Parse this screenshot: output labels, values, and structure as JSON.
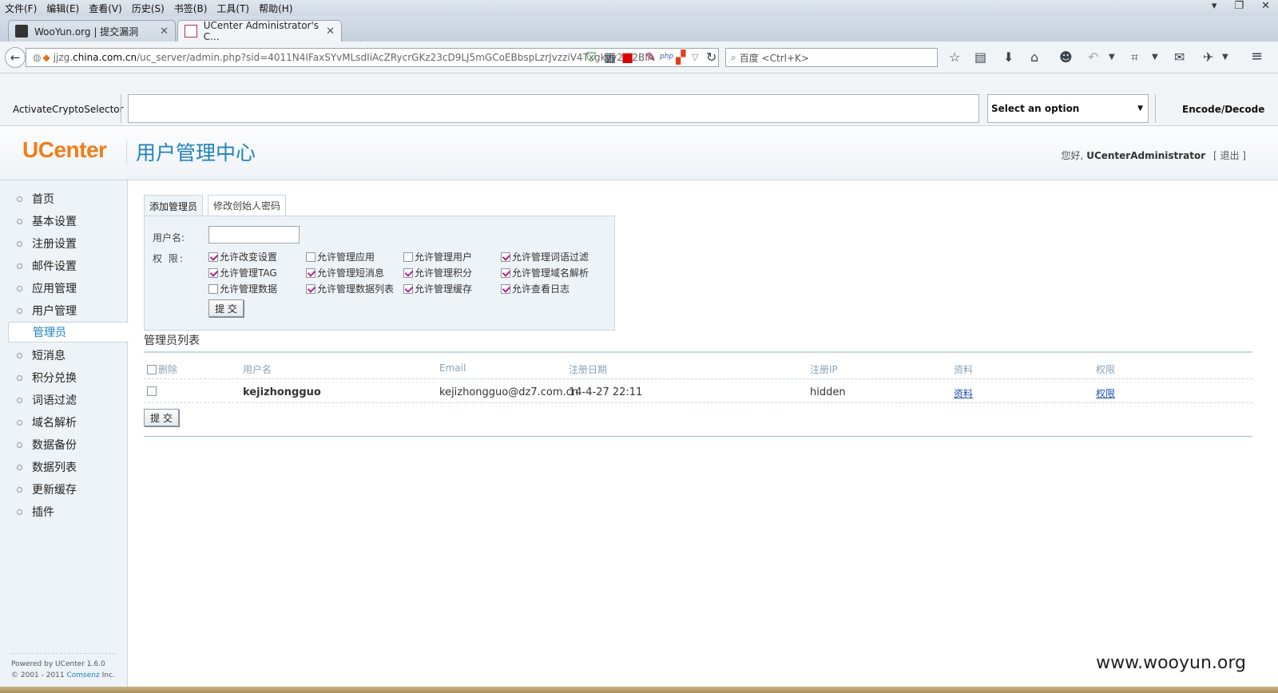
{
  "menubar": [
    "文件(F)",
    "编辑(E)",
    "查看(V)",
    "历史(S)",
    "书签(B)",
    "工具(T)",
    "帮助(H)"
  ],
  "tabs": [
    {
      "title": "WooYun.org | 提交漏洞",
      "active": false
    },
    {
      "title": "UCenter Administrator's C...",
      "active": true
    }
  ],
  "address": {
    "url_prefix": "jjzg.",
    "url_host": "china.com.cn",
    "url_rest": "/uc_server/admin.php?sid=4011N4IFaxSYvMLsdIiAcZRycrGKz23cD9LJ5mGCoEBbspLzrJvzziV4Txgkyy2%2BIA",
    "search_placeholder": "百度 <Ctrl+K>"
  },
  "cryptobar": {
    "label": "ActivateCryptoSelector",
    "select_value": "Select an option",
    "button": "Encode/Decode"
  },
  "header": {
    "logo": "UCenter",
    "title": "用户管理中心",
    "greeting": "您好,",
    "user": "UCenterAdministrator",
    "logout": "[ 退出 ]"
  },
  "sidebar": {
    "items": [
      "首页",
      "基本设置",
      "注册设置",
      "邮件设置",
      "应用管理",
      "用户管理",
      "管理员",
      "短消息",
      "积分兑换",
      "词语过滤",
      "域名解析",
      "数据备份",
      "数据列表",
      "更新缓存",
      "插件"
    ],
    "active_index": 6,
    "footer_line1": "Powered by UCenter 1.6.0",
    "footer_line2_prefix": "© 2001 - 2011 ",
    "footer_brand": "Comsenz",
    "footer_suffix": " Inc."
  },
  "content_tabs": [
    "添加管理员",
    "修改创始人密码"
  ],
  "form": {
    "username_label": "用户名:",
    "username_value": "",
    "perm_label": "权 限:",
    "permissions": [
      {
        "label": "允许改变设置",
        "checked": true
      },
      {
        "label": "允许管理应用",
        "checked": false
      },
      {
        "label": "允许管理用户",
        "checked": false
      },
      {
        "label": "允许管理词语过滤",
        "checked": true
      },
      {
        "label": "允许管理TAG",
        "checked": true
      },
      {
        "label": "允许管理短消息",
        "checked": true
      },
      {
        "label": "允许管理积分",
        "checked": true
      },
      {
        "label": "允许管理域名解析",
        "checked": true
      },
      {
        "label": "允许管理数据",
        "checked": false
      },
      {
        "label": "允许管理数据列表",
        "checked": true
      },
      {
        "label": "允许管理缓存",
        "checked": true
      },
      {
        "label": "允许查看日志",
        "checked": true
      }
    ],
    "submit": "提 交"
  },
  "admin_list": {
    "title": "管理员列表",
    "columns": [
      "删除",
      "用户名",
      "Email",
      "注册日期",
      "注册IP",
      "资料",
      "权限"
    ],
    "rows": [
      {
        "username": "kejizhongguo",
        "email": "kejizhongguo@dz7.com.cn",
        "regdate": "14-4-27 22:11",
        "regip": "hidden",
        "profile": "资料",
        "perm": "权限"
      }
    ],
    "submit": "提 交"
  },
  "watermark": "www.wooyun.org"
}
